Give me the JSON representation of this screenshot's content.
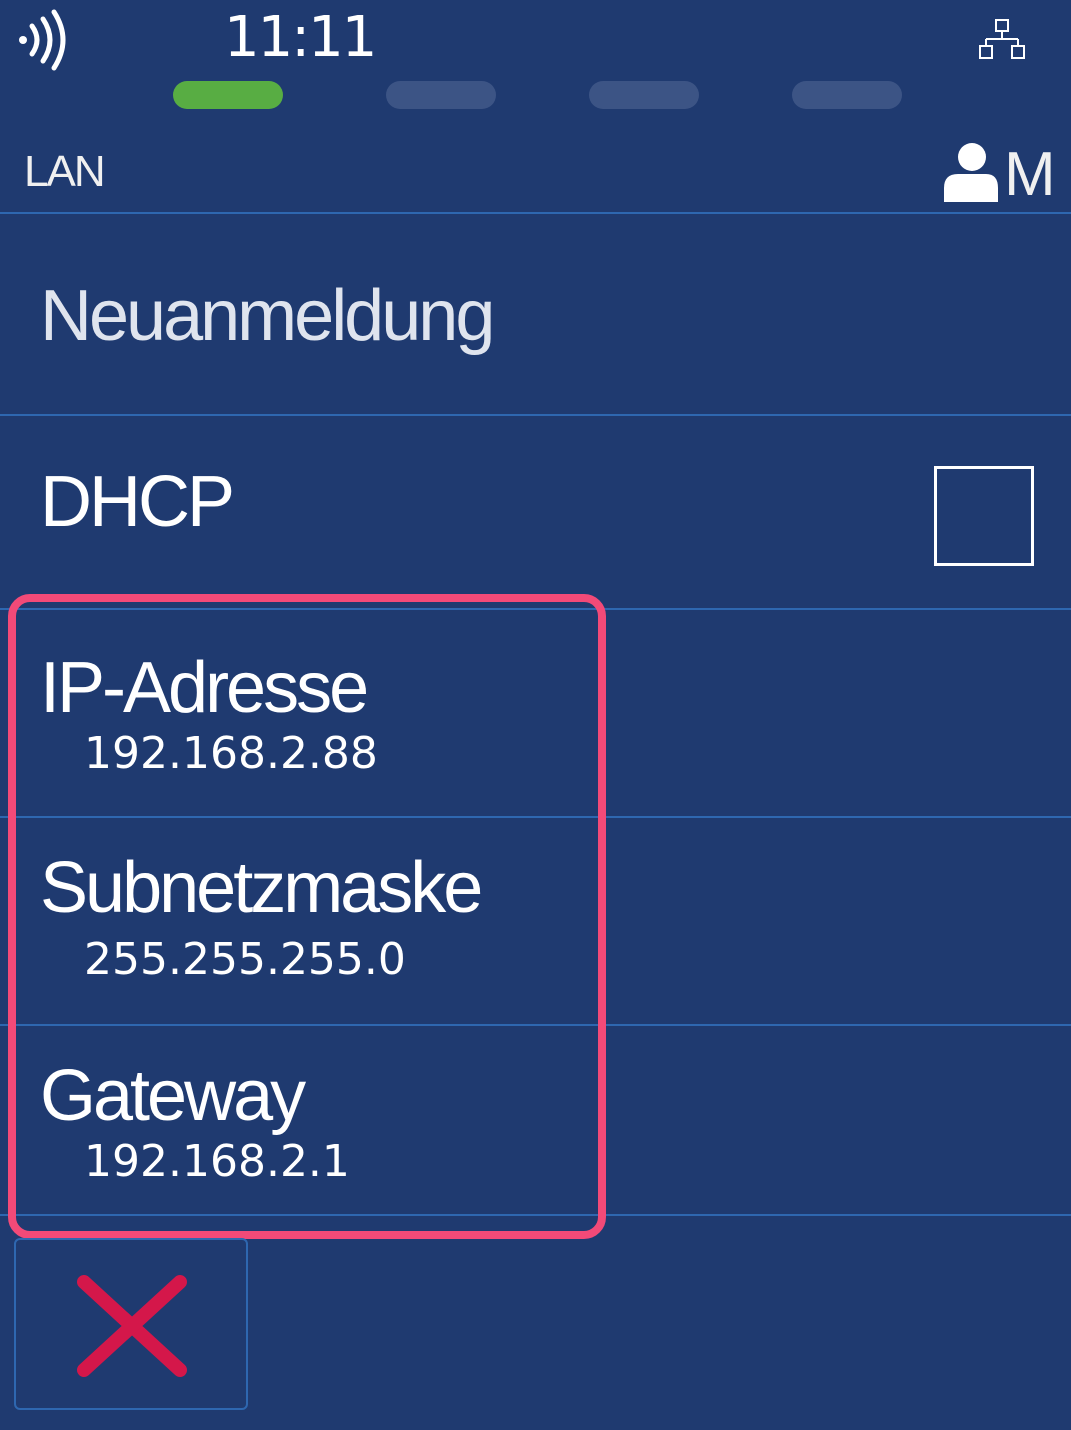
{
  "status_bar": {
    "time": "11:11",
    "contactless_icon": "contactless-icon",
    "network_icon": "network-icon"
  },
  "progress": {
    "steps": 4,
    "current": 1,
    "active_color": "#58ad43",
    "inactive_color": "#3c5485"
  },
  "header": {
    "title": "LAN",
    "user_icon": "user-icon",
    "user_level": "M"
  },
  "menu": {
    "new_login": {
      "label": "Neuanmeldung"
    },
    "dhcp": {
      "label": "DHCP",
      "checked": false
    },
    "ip_address": {
      "label": "IP-Adresse",
      "value": "192.168.2.88"
    },
    "subnet_mask": {
      "label": "Subnetzmaske",
      "value": "255.255.255.0"
    },
    "gateway": {
      "label": "Gateway",
      "value": "192.168.2.1"
    }
  },
  "footer": {
    "cancel_icon": "close-icon",
    "cancel_color": "#d4174a"
  },
  "colors": {
    "background": "#1f3a70",
    "divider": "#2e67b0",
    "highlight": "#f24a78"
  }
}
